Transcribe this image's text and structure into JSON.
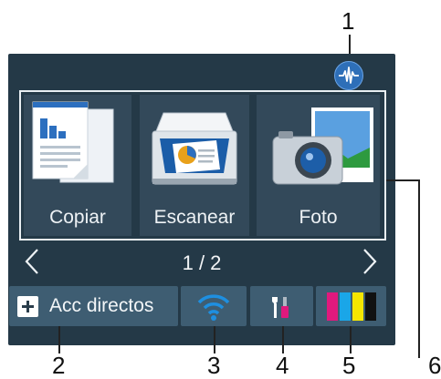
{
  "callouts": {
    "c1": "1",
    "c2": "2",
    "c3": "3",
    "c4": "4",
    "c5": "5",
    "c6": "6"
  },
  "functions": [
    {
      "label": "Copiar"
    },
    {
      "label": "Escanear"
    },
    {
      "label": "Foto"
    }
  ],
  "pager": {
    "text": "1 / 2"
  },
  "shortcuts": {
    "label": "Acc directos"
  },
  "colors": {
    "screen_bg": "#243947",
    "tile_bg": "#33495a",
    "button_bg": "#3e5d72",
    "wifi": "#1e8fe0",
    "ink_magenta": "#e0197d",
    "ink_cyan": "#1aa6e8",
    "ink_yellow": "#f5e600",
    "ink_black": "#111111"
  },
  "icons": {
    "status": "wireless-ad-hoc-icon",
    "wifi": "wifi-icon",
    "settings": "settings-tools-icon",
    "ink": "ink-cartridge-icon"
  }
}
